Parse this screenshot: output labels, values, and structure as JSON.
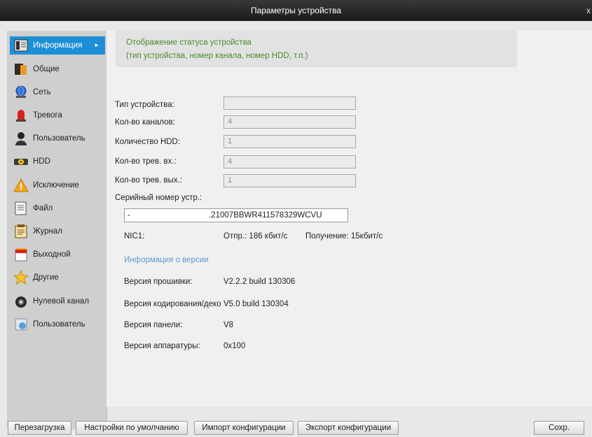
{
  "window": {
    "title": "Параметры устройства",
    "close_glyph": "x"
  },
  "sidebar": {
    "items": [
      {
        "label": "Информация",
        "icon": "info-book-icon",
        "active": true
      },
      {
        "label": "Общие",
        "icon": "general-folder-icon"
      },
      {
        "label": "Сеть",
        "icon": "network-globe-icon"
      },
      {
        "label": "Тревога",
        "icon": "alarm-siren-icon"
      },
      {
        "label": "Пользователь",
        "icon": "user-person-icon"
      },
      {
        "label": "HDD",
        "icon": "hdd-radiation-icon"
      },
      {
        "label": "Исключение",
        "icon": "warning-triangle-icon"
      },
      {
        "label": "Файл",
        "icon": "file-document-icon"
      },
      {
        "label": "Журнал",
        "icon": "log-notepad-icon"
      },
      {
        "label": "Выходной",
        "icon": "output-calendar-icon"
      },
      {
        "label": "Другие",
        "icon": "other-star-icon"
      },
      {
        "label": "Нулевой канал",
        "icon": "zero-channel-camera-icon"
      },
      {
        "label": "Пользователь",
        "icon": "user-server-icon"
      }
    ]
  },
  "status": {
    "line1": "Отображение статуса устройства",
    "line2": "(тип устройства, номер канала, номер HDD, т.п.)"
  },
  "fields": {
    "device_type": {
      "label": "Тип устройства:",
      "value": ""
    },
    "channels": {
      "label": "Кол-во каналов:",
      "value": "4"
    },
    "hdd_count": {
      "label": "Количество HDD:",
      "value": "1"
    },
    "alarm_in": {
      "label": "Кол-во трев. вх.:",
      "value": "4"
    },
    "alarm_out": {
      "label": "Кол-во трев. вых.:",
      "value": "1"
    }
  },
  "serial": {
    "label": "Серийный номер устр.:",
    "value_start": "-",
    "value_end": ".21007BBWR411578329WCVU"
  },
  "nic": {
    "label": "NIC1:",
    "send": "Отпр.: 186 кбит/с",
    "receive": "Получение: 15кбит/с"
  },
  "version": {
    "header": "Информация о версии",
    "firmware_label": "Версия прошивки:",
    "firmware_value": "V2.2.2 build 130306",
    "encoding_label": "Версия кодирования/деко",
    "encoding_value": "V5.0 build 130304",
    "panel_label": "Версия панели:",
    "panel_value": "V8",
    "hardware_label": "Версия аппаратуры:",
    "hardware_value": "0x100"
  },
  "buttons": {
    "reboot": "Перезагрузка",
    "defaults": "Настройки по умолчанию",
    "import": "Импорт конфигурации",
    "export": "Экспорт конфигурации",
    "save": "Сохр."
  }
}
